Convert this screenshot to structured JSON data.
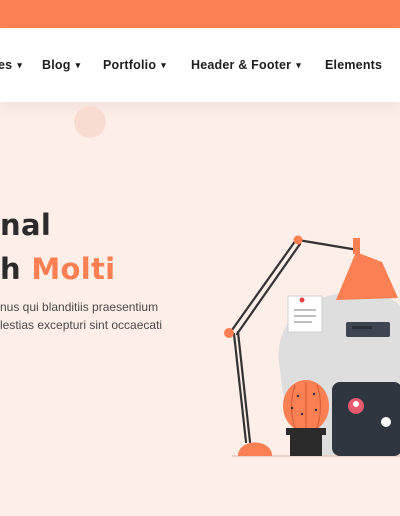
{
  "colors": {
    "accent": "#fa7f52",
    "background": "#fdeee8",
    "text": "#2b2b2b"
  },
  "nav": {
    "items": [
      {
        "label": "es",
        "icon": "chevron-down-icon"
      },
      {
        "label": "Blog",
        "icon": "chevron-down-icon"
      },
      {
        "label": "Portfolio",
        "icon": "chevron-down-icon"
      },
      {
        "label": "Header & Footer",
        "icon": "chevron-down-icon"
      },
      {
        "label": "Elements"
      }
    ]
  },
  "hero": {
    "title_line1": "nal",
    "title_line2_prefix": "h ",
    "title_line2_accent": "Molti",
    "text_line1": "nus qui blanditiis praesentium",
    "text_line2": "lestias excepturi sint occaecati"
  },
  "illustration": {
    "name": "desk-lamp-illustration"
  }
}
